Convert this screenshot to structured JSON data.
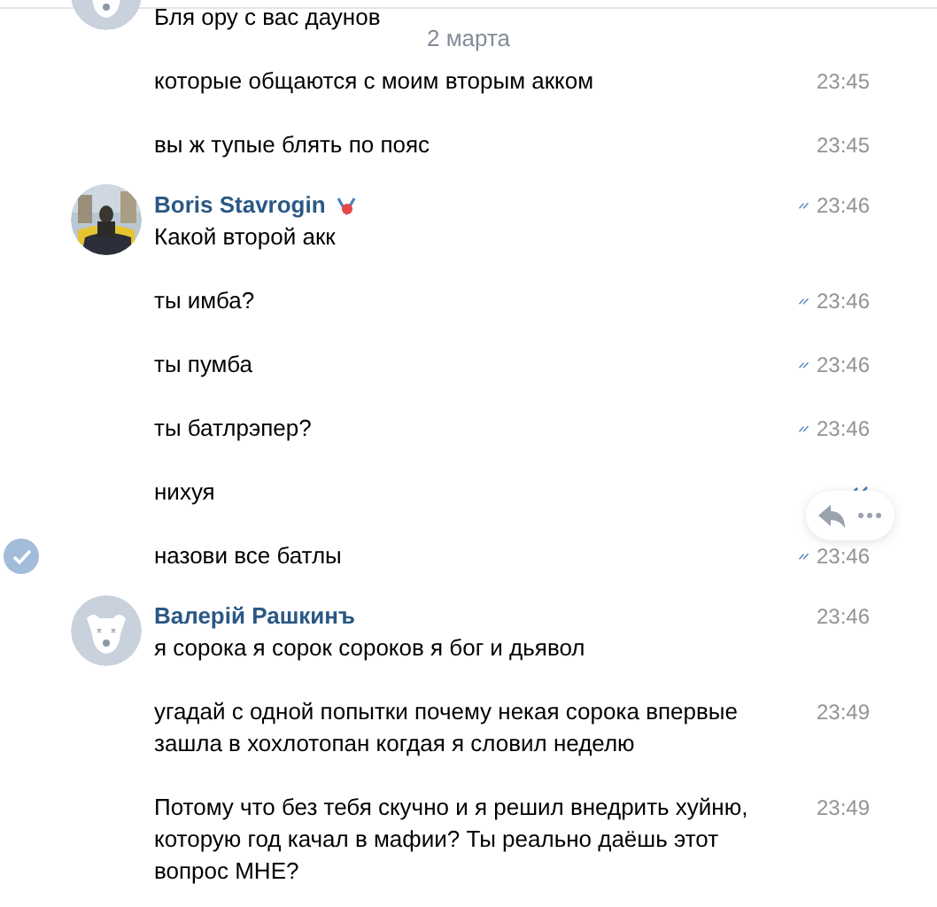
{
  "date_pill": "2 марта",
  "groups": [
    {
      "author": {
        "avatar": {
          "kind": "default"
        }
      },
      "messages": [
        {
          "text": "Бля ору с вас даунов",
          "selected": false,
          "hovered": false,
          "read": false
        },
        {
          "text": "которые общаются с моим вторым акком",
          "time": "23:45",
          "selected": false,
          "hovered": false,
          "read": false
        },
        {
          "text": "вы ж тупые блять по пояс",
          "time": "23:45",
          "selected": false,
          "hovered": false,
          "read": false
        }
      ]
    },
    {
      "author": {
        "name": "Boris Stavrogin",
        "badge": true
      },
      "messages": [
        {
          "text": "Какой второй акк",
          "time": "23:46",
          "selected": false,
          "hovered": false,
          "read": true
        },
        {
          "text": "ты имба?",
          "time": "23:46",
          "selected": false,
          "hovered": false,
          "read": true
        },
        {
          "text": "ты пумба",
          "time": "23:46",
          "selected": false,
          "hovered": false,
          "read": true
        },
        {
          "text": "ты батлрэпер?",
          "time": "23:46",
          "selected": false,
          "hovered": false,
          "read": true
        },
        {
          "text": "нихуя",
          "selected": false,
          "hovered": true,
          "read": true
        },
        {
          "text": "назови все батлы",
          "time": "23:46",
          "selected": true,
          "hovered": false,
          "read": true
        }
      ]
    },
    {
      "author": {
        "name": "Валерій Рашкинъ",
        "avatar": {
          "kind": "default"
        }
      },
      "messages": [
        {
          "text": "я сорока я сорок сороков я бог и дьявол",
          "time": "23:46",
          "selected": false,
          "hovered": false,
          "read": false
        },
        {
          "text": "угадай с одной попытки почему некая сорока впервые зашла в хохлотопан когдая я словил неделю",
          "time": "23:49",
          "selected": false,
          "hovered": false,
          "read": false
        },
        {
          "text": "Потому что без тебя скучно и я решил внедрить хуйню, которую год качал в мафии? Ты реально даёшь этот вопрос МНЕ?",
          "time": "23:49",
          "selected": false,
          "hovered": false,
          "read": false
        }
      ]
    }
  ]
}
